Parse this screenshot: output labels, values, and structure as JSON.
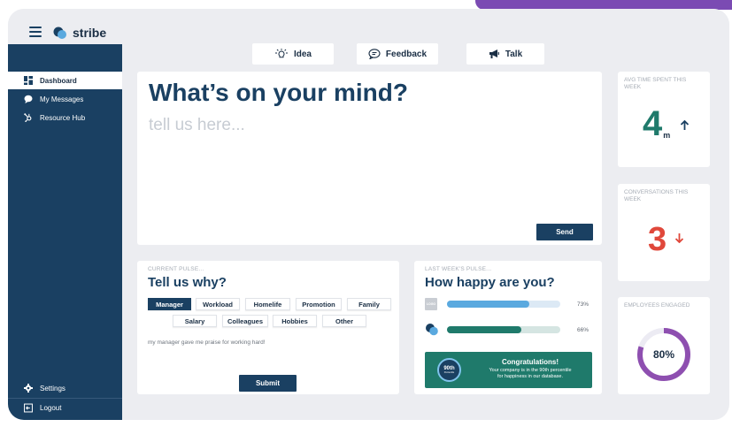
{
  "brand": {
    "name": "stribe"
  },
  "sidebar": {
    "items": [
      {
        "label": "Dashboard",
        "active": true
      },
      {
        "label": "My Messages"
      },
      {
        "label": "Resource Hub"
      }
    ],
    "settings_label": "Settings",
    "logout_label": "Logout"
  },
  "tabs": [
    {
      "label": "Idea",
      "icon": "lightbulb-icon"
    },
    {
      "label": "Feedback",
      "icon": "chat-bubble-icon"
    },
    {
      "label": "Talk",
      "icon": "megaphone-icon"
    }
  ],
  "mind": {
    "title": "What’s on your mind?",
    "placeholder": "tell us here...",
    "send_label": "Send"
  },
  "pulse": {
    "label": "CURRENT PULSE...",
    "title": "Tell us why?",
    "chips": [
      "Manager",
      "Workload",
      "Homelife",
      "Promotion",
      "Family",
      "Salary",
      "Colleagues",
      "Hobbies",
      "Other"
    ],
    "selected_chip": "Manager",
    "comment": "my manager gave me praise for working hard!",
    "submit_label": "Submit"
  },
  "happy": {
    "label": "LAST WEEK'S PULSE...",
    "title": "How happy are you?",
    "bars": [
      {
        "logo_text": "LOGO",
        "value": 73,
        "value_label": "73%",
        "color": "#5aa9df",
        "track": "#dce9f5"
      },
      {
        "logo_text": "",
        "value": 66,
        "value_label": "66%",
        "color": "#1f7a6b",
        "track": "#d5e5e2"
      }
    ],
    "congrats": {
      "badge": "90th",
      "badge_sub": "Percentile",
      "title": "Congratulations!",
      "line1": "Your company is in the 90th percentile",
      "line2": "for happiness in our database."
    }
  },
  "stats": {
    "avg_time": {
      "label": "AVG TIME SPENT THIS WEEK",
      "value": "4",
      "unit": "m",
      "trend": "up",
      "color": "#1f7a6b"
    },
    "conversations": {
      "label": "CONVERSATIONS THIS WEEK",
      "value": "3",
      "trend": "down",
      "color": "#e0483b"
    },
    "engaged": {
      "label": "EMPLOYEES ENGAGED",
      "value": "80%",
      "percent": 80,
      "color": "#8e4fb0"
    }
  },
  "colors": {
    "navy": "#1a4062",
    "purple": "#7b4bb3",
    "green": "#1f7a6b",
    "red": "#e0483b",
    "blue": "#5aa9df"
  }
}
